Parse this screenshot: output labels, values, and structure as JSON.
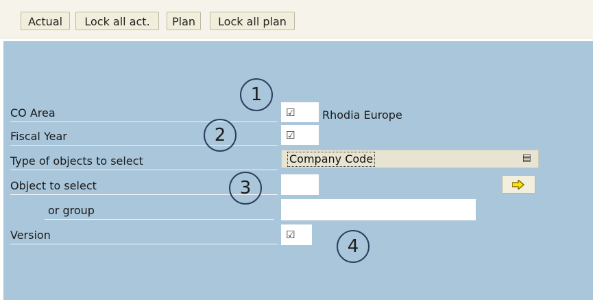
{
  "toolbar": {
    "buttons": [
      "Actual",
      "Lock all act.",
      "Plan",
      "Lock all plan"
    ]
  },
  "form": {
    "co_area": {
      "label": "CO Area",
      "value_text": "Rhodia Europe"
    },
    "fiscal_year": {
      "label": "Fiscal Year"
    },
    "type_objects": {
      "label": "Type of objects to select",
      "selected": "Company Code"
    },
    "object_select": {
      "label": "Object to select"
    },
    "or_group": {
      "label": "or group"
    },
    "version": {
      "label": "Version"
    }
  },
  "icons": {
    "checkbox": "☑",
    "dropdown": "▤",
    "execute": "arrow-right-icon"
  },
  "callouts": [
    "1",
    "2",
    "3",
    "4"
  ],
  "colors": {
    "toolbar_bg": "#f6f4ea",
    "main_bg": "#a9c6da",
    "button_bg": "#f2eedc",
    "arrow_yellow": "#f6e600"
  }
}
